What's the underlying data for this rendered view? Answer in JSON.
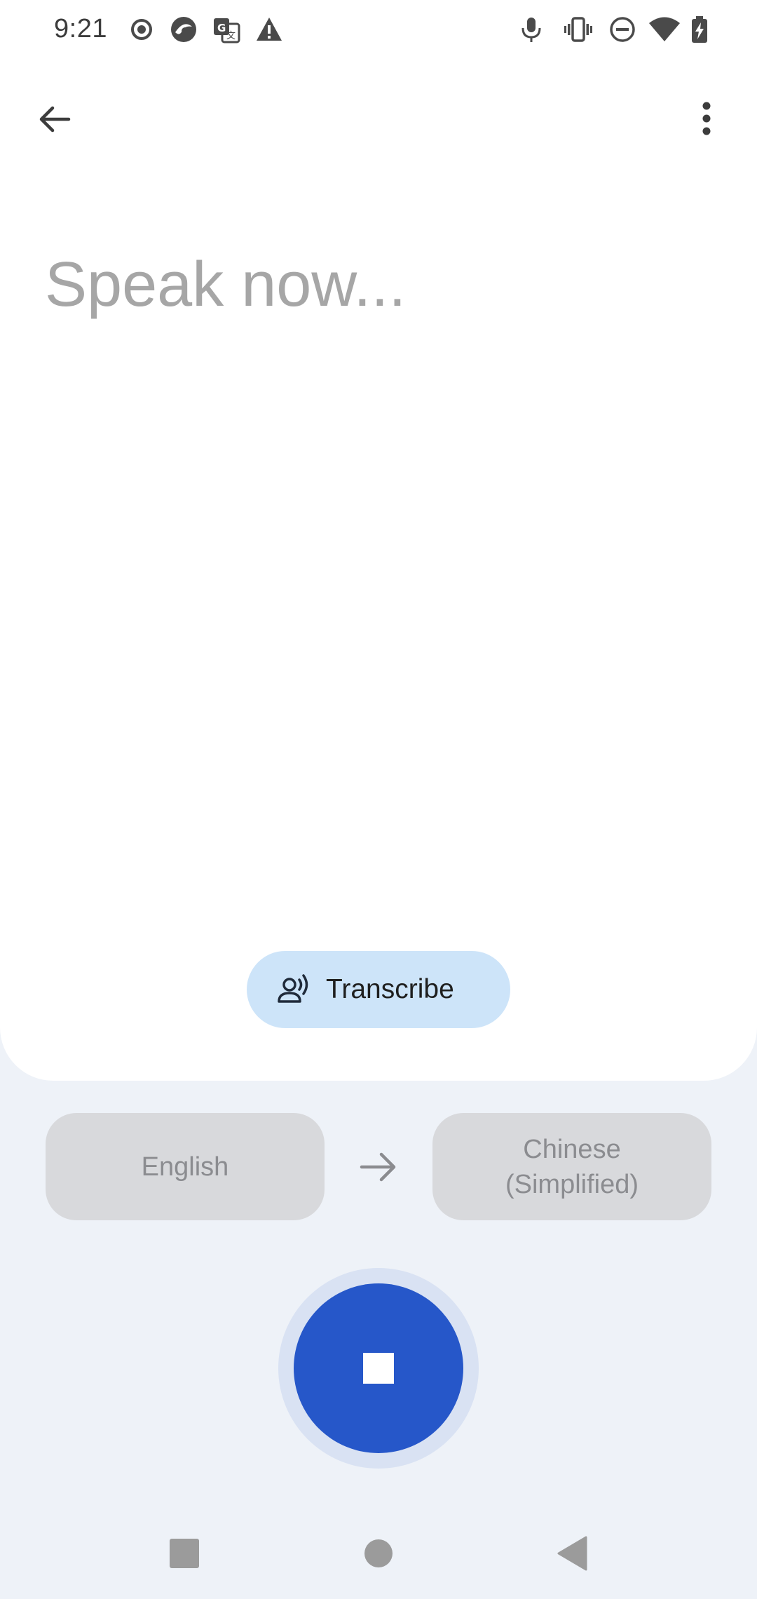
{
  "status_bar": {
    "time": "9:21",
    "left_icons": [
      "record-icon",
      "assistant-icon",
      "translate-icon",
      "warning-icon"
    ],
    "right_icons": [
      "mic-icon",
      "vibrate-icon",
      "do-not-disturb-icon",
      "wifi-icon",
      "battery-charging-icon"
    ]
  },
  "app_bar": {
    "back_icon": "arrow-back-icon",
    "menu_icon": "more-vert-icon"
  },
  "prompt": "Speak now...",
  "transcribe": {
    "label": "Transcribe",
    "icon": "person-voice-icon"
  },
  "languages": {
    "source": "English",
    "target_line1": "Chinese",
    "target_line2": "(Simplified)",
    "arrow_icon": "arrow-right-icon"
  },
  "mic_button": {
    "state": "recording",
    "icon": "stop-icon"
  },
  "nav_bar": {
    "items": [
      "recents-icon",
      "home-icon",
      "back-icon"
    ]
  },
  "colors": {
    "background": "#eef2f8",
    "card": "#ffffff",
    "accent": "#2657c9",
    "transcribe_bg": "#cde4f9",
    "lang_bg": "#d8d9dc",
    "prompt_text": "#a6a6a6"
  }
}
